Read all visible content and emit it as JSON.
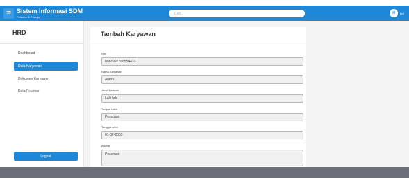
{
  "header": {
    "menu_icon": "hamburger-icon",
    "title": "Sistem Informasi SDM",
    "subtitle": "Pelamar & Pekerja",
    "search_placeholder": "Cari...",
    "user_initial": "H",
    "user_name": "hrd"
  },
  "sidebar": {
    "title": "HRD",
    "items": [
      {
        "label": "Dashboard",
        "active": false
      },
      {
        "label": "Data Karyawan",
        "active": true
      },
      {
        "label": "Dokumen Karyawan",
        "active": false
      },
      {
        "label": "Data Pelamar",
        "active": false
      }
    ],
    "logout_label": "Logout"
  },
  "form": {
    "title": "Tambah Karyawan",
    "fields": [
      {
        "label": "NIK",
        "value": "0088997766554433"
      },
      {
        "label": "Nama Karyawan",
        "value": "Anton"
      },
      {
        "label": "Jenis Kelamin",
        "value": "Laki-laki"
      },
      {
        "label": "Tempat Lahir",
        "value": "Pesuruan"
      },
      {
        "label": "Tanggal Lahir",
        "value": "01-02-2003"
      },
      {
        "label": "Alamat",
        "value": "Pesuruan"
      }
    ]
  },
  "colors": {
    "primary": "#1e88d6",
    "content_bg": "#f4f4f4",
    "footer_bar": "#6b6f78"
  }
}
